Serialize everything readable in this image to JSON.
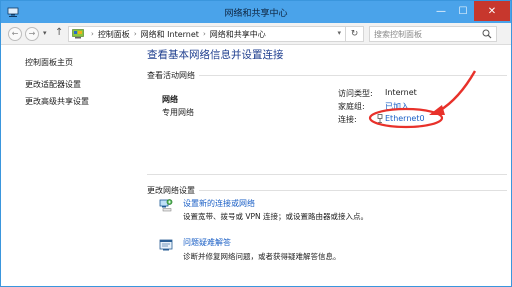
{
  "window": {
    "title": "网络和共享中心",
    "controls": {
      "minimize": "—",
      "maximize": "☐",
      "close": "✕"
    }
  },
  "address": {
    "back": "←",
    "forward": "→",
    "up": "↑",
    "breadcrumb": [
      "控制面板",
      "网络和 Internet",
      "网络和共享中心"
    ],
    "refresh": "↻",
    "search_placeholder": "搜索控制面板"
  },
  "sidebar": {
    "items": [
      {
        "label": "控制面板主页"
      },
      {
        "label": "更改适配器设置"
      },
      {
        "label": "更改高级共享设置"
      }
    ]
  },
  "main": {
    "title": "查看基本网络信息并设置连接",
    "active_section": "查看活动网络",
    "network": {
      "name": "网络",
      "type": "专用网络"
    },
    "properties": {
      "access_label": "访问类型:",
      "access_value": "Internet",
      "homegroup_label": "家庭组:",
      "homegroup_value": "已加入",
      "connection_label": "连接:",
      "connection_value": "Ethernet0"
    },
    "change_section": "更改网络设置",
    "tasks": [
      {
        "title": "设置新的连接或网络",
        "desc": "设置宽带、拨号或 VPN 连接；或设置路由器或接入点。",
        "icon": "network-setup-icon"
      },
      {
        "title": "问题疑难解答",
        "desc": "诊断并修复网络问题，或者获得疑难解答信息。",
        "icon": "troubleshoot-icon"
      }
    ]
  },
  "colors": {
    "titlebar": "#4aa3ea",
    "close": "#c7372d",
    "link": "#1a5fc6",
    "heading": "#1f3f8f",
    "annotation": "#e8312a"
  }
}
